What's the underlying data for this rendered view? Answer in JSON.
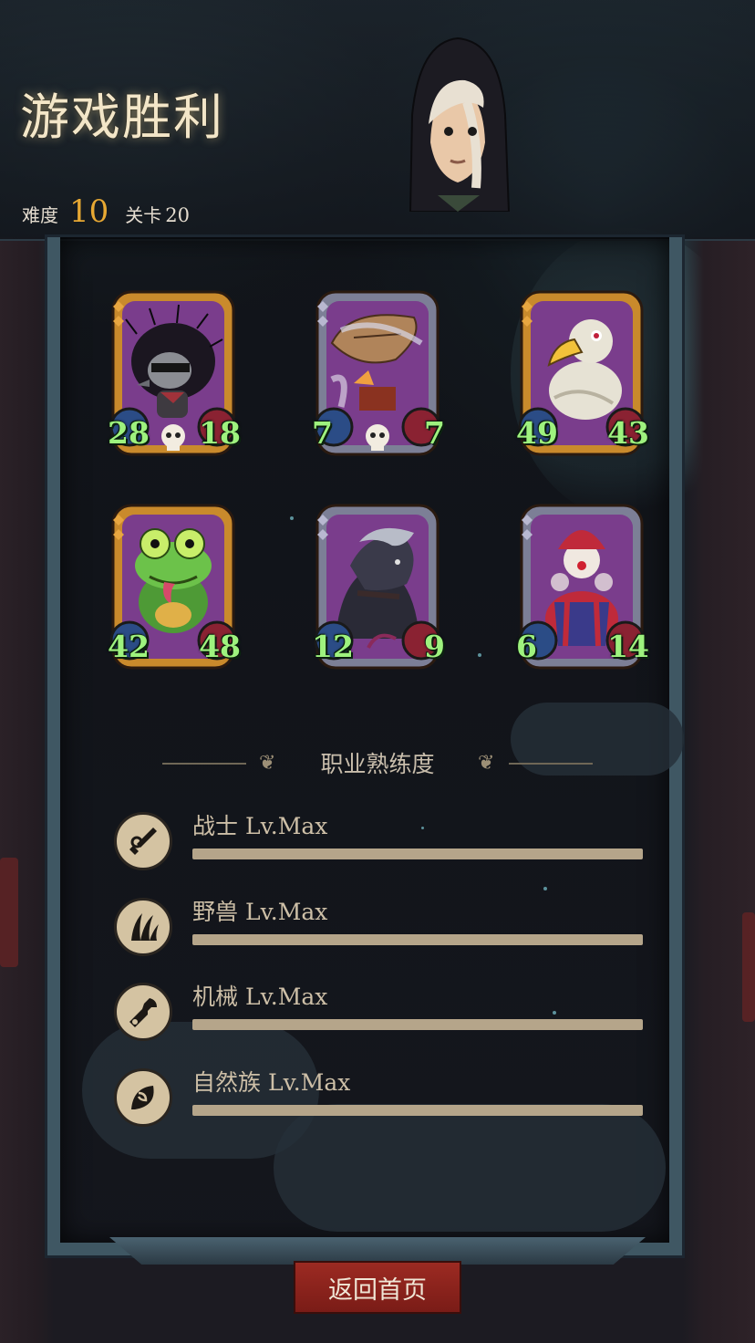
{
  "header": {
    "title": "游戏胜利",
    "difficulty_label": "难度",
    "difficulty_value": "10",
    "stage_label": "关卡",
    "stage_value": "20"
  },
  "cards": [
    {
      "creature": "hedgehog",
      "frame": "gold",
      "attack": "28",
      "health": "18",
      "skull": true,
      "frame_color": "#c98a2c",
      "art_color": "#7a3d8c"
    },
    {
      "creature": "airship",
      "frame": "silver",
      "attack": "7",
      "health": "7",
      "skull": true,
      "frame_color": "#7c7f96",
      "art_color": "#7a3d8c"
    },
    {
      "creature": "vulture",
      "frame": "gold",
      "attack": "49",
      "health": "43",
      "skull": false,
      "frame_color": "#c98a2c",
      "art_color": "#7a3d8c"
    },
    {
      "creature": "frog",
      "frame": "gold",
      "attack": "42",
      "health": "48",
      "skull": false,
      "frame_color": "#c98a2c",
      "art_color": "#7a3d8c"
    },
    {
      "creature": "wolf",
      "frame": "silver",
      "attack": "12",
      "health": "9",
      "skull": false,
      "frame_color": "#7c7f96",
      "art_color": "#7a3d8c"
    },
    {
      "creature": "clown",
      "frame": "silver",
      "attack": "6",
      "health": "14",
      "skull": false,
      "frame_color": "#7c7f96",
      "art_color": "#7a3d8c"
    }
  ],
  "mastery": {
    "title": "职业熟练度",
    "items": [
      {
        "name": "战士",
        "level": "Lv.Max",
        "progress": 1.0,
        "icon": "sword-icon"
      },
      {
        "name": "野兽",
        "level": "Lv.Max",
        "progress": 1.0,
        "icon": "claw-icon"
      },
      {
        "name": "机械",
        "level": "Lv.Max",
        "progress": 1.0,
        "icon": "wrench-icon"
      },
      {
        "name": "自然族",
        "level": "Lv.Max",
        "progress": 1.0,
        "icon": "leaf-icon"
      }
    ]
  },
  "footer": {
    "home_label": "返回首页"
  },
  "colors": {
    "accent_gold": "#e7a833",
    "stat_green": "#9ef27e",
    "button_red": "#8c231c"
  }
}
